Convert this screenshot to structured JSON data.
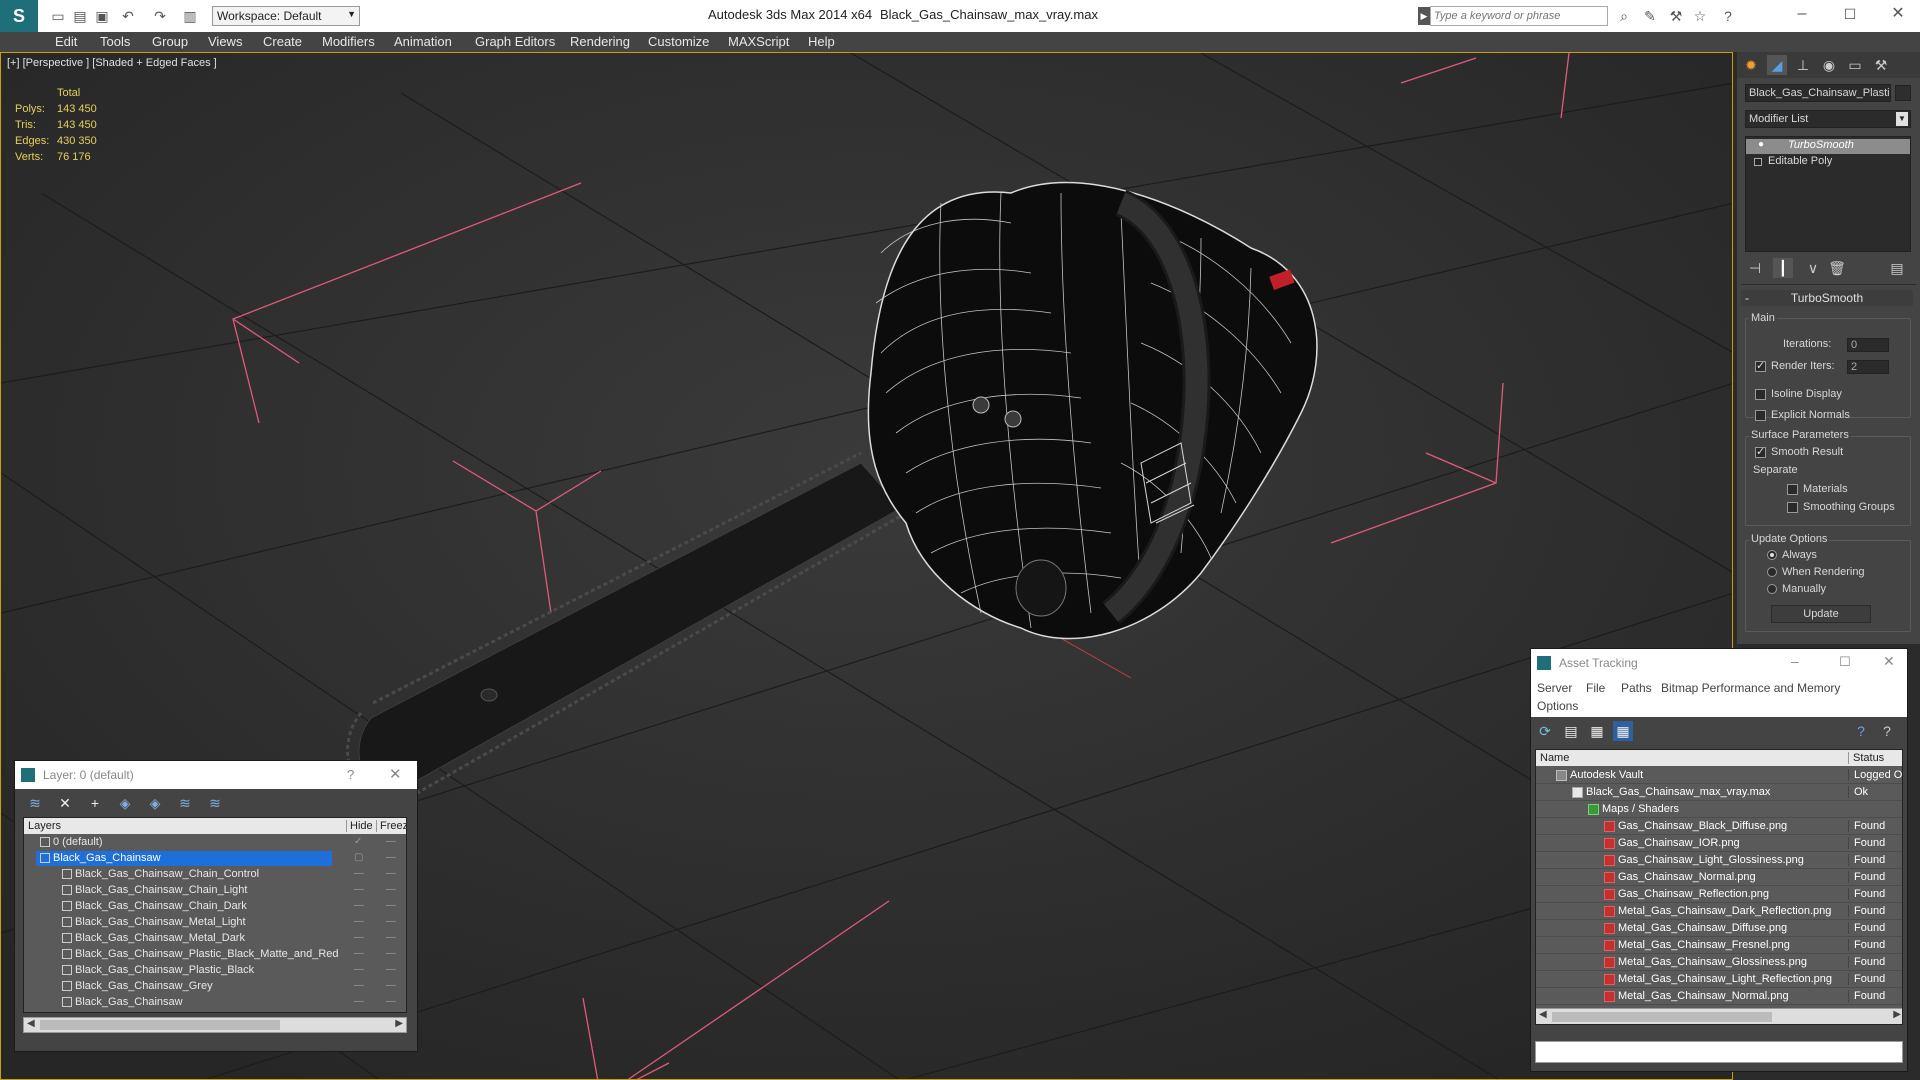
{
  "titlebar": {
    "app_title": "Autodesk 3ds Max  2014 x64",
    "file_name": "Black_Gas_Chainsaw_max_vray.max",
    "workspace": "Workspace: Default",
    "search_placeholder": "Type a keyword or phrase"
  },
  "menu": [
    "Edit",
    "Tools",
    "Group",
    "Views",
    "Create",
    "Modifiers",
    "Animation",
    "Graph Editors",
    "Rendering",
    "Customize",
    "MAXScript",
    "Help"
  ],
  "viewport": {
    "label": "[+] [Perspective ] [Shaded + Edged Faces ]",
    "stats": {
      "header": "Total",
      "rows": [
        {
          "label": "Polys:",
          "value": "143 450"
        },
        {
          "label": "Tris:",
          "value": "143 450"
        },
        {
          "label": "Edges:",
          "value": "430 350"
        },
        {
          "label": "Verts:",
          "value": "76 176"
        }
      ]
    }
  },
  "command_panel": {
    "object_name": "Black_Gas_Chainsaw_Plastic_",
    "modifier_list": "Modifier List",
    "stack": [
      "TurboSmooth",
      "Editable Poly"
    ],
    "rollout_title": "TurboSmooth",
    "main_label": "Main",
    "iterations_label": "Iterations:",
    "iterations_value": "0",
    "render_iters_label": "Render Iters:",
    "render_iters_value": "2",
    "isoline": "Isoline Display",
    "explicit": "Explicit Normals",
    "surface_label": "Surface Parameters",
    "smooth_result": "Smooth Result",
    "separate_label": "Separate",
    "materials": "Materials",
    "smoothing_groups": "Smoothing Groups",
    "update_label": "Update Options",
    "always": "Always",
    "when_rendering": "When Rendering",
    "manually": "Manually",
    "update_button": "Update"
  },
  "layer_dialog": {
    "title": "Layer: 0 (default)",
    "help": "?",
    "col_layers": "Layers",
    "col_hide": "Hide",
    "col_freeze": "Freez",
    "rows": [
      {
        "name": "0 (default)"
      },
      {
        "name": "Black_Gas_Chainsaw"
      },
      {
        "name": "Black_Gas_Chainsaw_Chain_Control"
      },
      {
        "name": "Black_Gas_Chainsaw_Chain_Light"
      },
      {
        "name": "Black_Gas_Chainsaw_Chain_Dark"
      },
      {
        "name": "Black_Gas_Chainsaw_Metal_Light"
      },
      {
        "name": "Black_Gas_Chainsaw_Metal_Dark"
      },
      {
        "name": "Black_Gas_Chainsaw_Plastic_Black_Matte_and_Red"
      },
      {
        "name": "Black_Gas_Chainsaw_Plastic_Black"
      },
      {
        "name": "Black_Gas_Chainsaw_Grey"
      },
      {
        "name": "Black_Gas_Chainsaw"
      }
    ]
  },
  "asset_dialog": {
    "title": "Asset Tracking",
    "menu": [
      "Server",
      "File",
      "Paths",
      "Bitmap Performance and Memory",
      "Options"
    ],
    "col_name": "Name",
    "col_status": "Status",
    "rows": [
      {
        "name": "Autodesk Vault",
        "status": "Logged O"
      },
      {
        "name": "Black_Gas_Chainsaw_max_vray.max",
        "status": "Ok"
      },
      {
        "name": "Maps / Shaders",
        "status": ""
      },
      {
        "name": "Gas_Chainsaw_Black_Diffuse.png",
        "status": "Found"
      },
      {
        "name": "Gas_Chainsaw_IOR.png",
        "status": "Found"
      },
      {
        "name": "Gas_Chainsaw_Light_Glossiness.png",
        "status": "Found"
      },
      {
        "name": "Gas_Chainsaw_Normal.png",
        "status": "Found"
      },
      {
        "name": "Gas_Chainsaw_Reflection.png",
        "status": "Found"
      },
      {
        "name": "Metal_Gas_Chainsaw_Dark_Reflection.png",
        "status": "Found"
      },
      {
        "name": "Metal_Gas_Chainsaw_Diffuse.png",
        "status": "Found"
      },
      {
        "name": "Metal_Gas_Chainsaw_Fresnel.png",
        "status": "Found"
      },
      {
        "name": "Metal_Gas_Chainsaw_Glossiness.png",
        "status": "Found"
      },
      {
        "name": "Metal_Gas_Chainsaw_Light_Reflection.png",
        "status": "Found"
      },
      {
        "name": "Metal_Gas_Chainsaw_Normal.png",
        "status": "Found"
      }
    ]
  },
  "colors": {
    "accent_blue": "#1e6fd9",
    "viewport_border": "#c9a200",
    "stats_text": "#e6d05a",
    "gizmo_pink": "#e05a7a"
  }
}
